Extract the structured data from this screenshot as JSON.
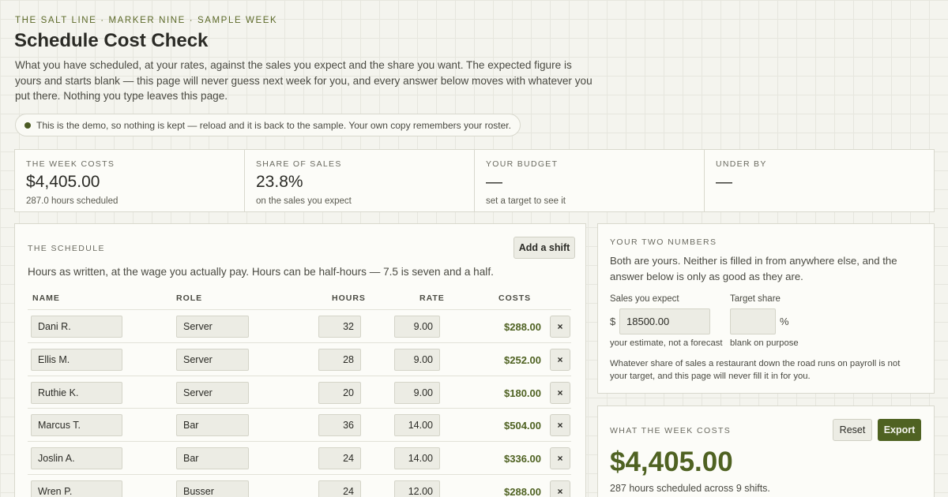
{
  "header": {
    "eyebrow": "THE SALT LINE · MARKER NINE · SAMPLE WEEK",
    "title": "Schedule Cost Check",
    "intro": "What you have scheduled, at your rates, against the sales you expect and the share you want. The expected figure is yours and starts blank — this page will never guess next week for you, and every answer below moves with whatever you put there. Nothing you type leaves this page."
  },
  "notice": "This is the demo, so nothing is kept — reload and it is back to the sample. Your own copy remembers your roster.",
  "stats": [
    {
      "label": "THE WEEK COSTS",
      "value": "$4,405.00",
      "sub": "287.0 hours scheduled"
    },
    {
      "label": "SHARE OF SALES",
      "value": "23.8%",
      "sub": "on the sales you expect"
    },
    {
      "label": "YOUR BUDGET",
      "value": "—",
      "sub": "set a target to see it"
    },
    {
      "label": "UNDER BY",
      "value": "—",
      "sub": ""
    }
  ],
  "schedule": {
    "title": "THE SCHEDULE",
    "add_label": "Add a shift",
    "description": "Hours as written, at the wage you actually pay. Hours can be half-hours — 7.5 is seven and a half.",
    "columns": {
      "name": "NAME",
      "role": "ROLE",
      "hours": "HOURS",
      "rate": "RATE",
      "costs": "COSTS"
    },
    "delete_label": "×",
    "rows": [
      {
        "name": "Dani R.",
        "role": "Server",
        "hours": "32",
        "rate": "9.00",
        "cost": "$288.00"
      },
      {
        "name": "Ellis M.",
        "role": "Server",
        "hours": "28",
        "rate": "9.00",
        "cost": "$252.00"
      },
      {
        "name": "Ruthie K.",
        "role": "Server",
        "hours": "20",
        "rate": "9.00",
        "cost": "$180.00"
      },
      {
        "name": "Marcus T.",
        "role": "Bar",
        "hours": "36",
        "rate": "14.00",
        "cost": "$504.00"
      },
      {
        "name": "Joslin A.",
        "role": "Bar",
        "hours": "24",
        "rate": "14.00",
        "cost": "$336.00"
      },
      {
        "name": "Wren P.",
        "role": "Busser",
        "hours": "24",
        "rate": "12.00",
        "cost": "$288.00"
      }
    ]
  },
  "numbers": {
    "title": "YOUR TWO NUMBERS",
    "description": "Both are yours. Neither is filled in from anywhere else, and the answer below is only as good as they are.",
    "sales_label": "Sales you expect",
    "currency": "$",
    "sales_value": "18500.00",
    "sales_help": "your estimate, not a forecast",
    "target_label": "Target share",
    "target_value": "",
    "percent": "%",
    "target_help": "blank on purpose",
    "note": "Whatever share of sales a restaurant down the road runs on payroll is not your target, and this page will never fill it in for you."
  },
  "week_costs": {
    "title": "WHAT THE WEEK COSTS",
    "reset_label": "Reset",
    "export_label": "Export",
    "total": "$4,405.00",
    "summary": "287 hours scheduled across 9 shifts."
  },
  "colors": {
    "accent": "#4f6222",
    "background": "#f4f4ee",
    "panel": "#fcfcf8"
  }
}
